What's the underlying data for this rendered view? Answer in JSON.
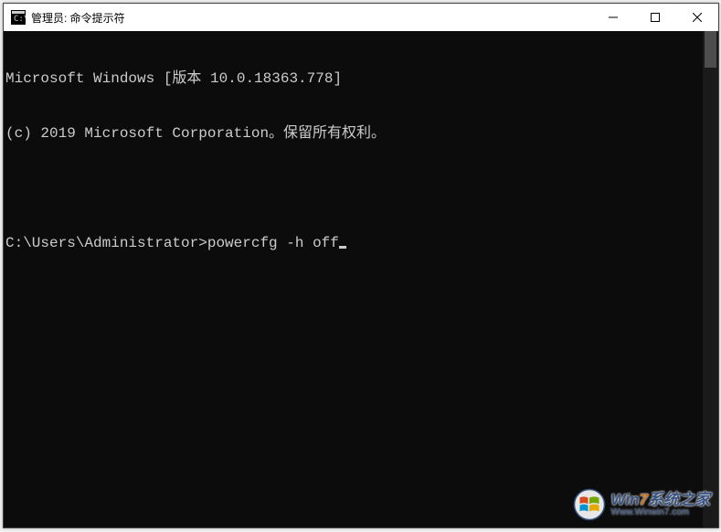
{
  "titlebar": {
    "title": "管理员: 命令提示符"
  },
  "terminal": {
    "header_line": "Microsoft Windows [版本 10.0.18363.778]",
    "copyright_line": "(c) 2019 Microsoft Corporation。保留所有权利。",
    "prompt_path": "C:\\Users\\Administrator>",
    "typed_command": "powercfg -h off"
  },
  "watermark": {
    "brand_prefix": "Win",
    "brand_highlight": "7",
    "brand_suffix": "系统之家",
    "url": "Www.Winwin7.com"
  }
}
